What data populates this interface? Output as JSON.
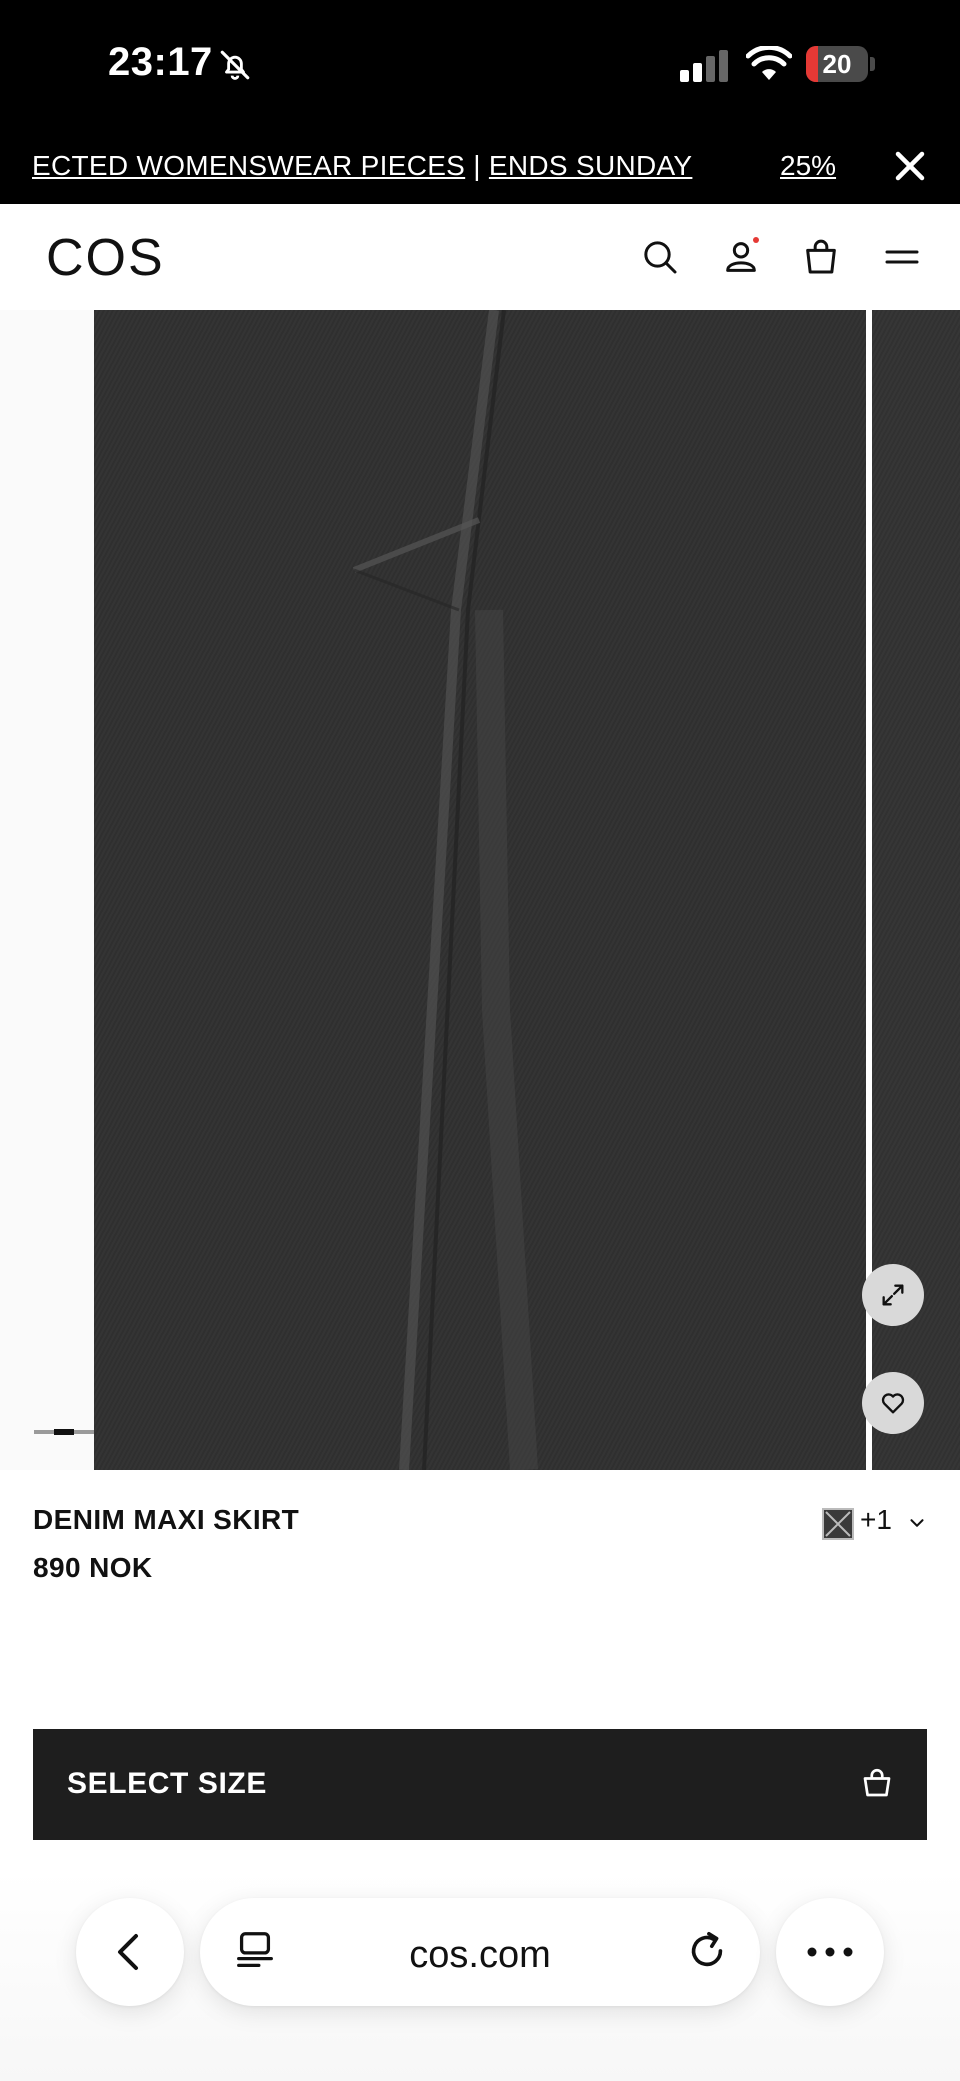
{
  "status_bar": {
    "time": "23:17",
    "battery": "20",
    "battery_level": 0.2
  },
  "promo": {
    "text_start": "ECTED WOMENSWEAR PIECES",
    "separator": " | ",
    "text_end": "ENDS SUNDAY",
    "text_next": "25%"
  },
  "header": {
    "logo": "COS"
  },
  "gallery": {
    "image_progress": 0.33
  },
  "product": {
    "name": "DENIM MAXI SKIRT",
    "price": "890 NOK",
    "more_colors": "+1"
  },
  "actions": {
    "select_size": "SELECT SIZE"
  },
  "browser": {
    "url": "cos.com"
  },
  "icons": {
    "status": [
      "bell-slash-icon",
      "signal-icon",
      "wifi-icon",
      "battery-icon"
    ],
    "header": [
      "search-icon",
      "account-icon",
      "bag-icon",
      "menu-icon"
    ],
    "gallery": [
      "expand-icon",
      "heart-icon"
    ],
    "browser": [
      "back-icon",
      "tabs-icon",
      "reload-icon",
      "more-icon"
    ]
  },
  "colors": {
    "accent_red": "#e53935",
    "button_bg": "#1e1e1e",
    "denim": "#333333"
  }
}
